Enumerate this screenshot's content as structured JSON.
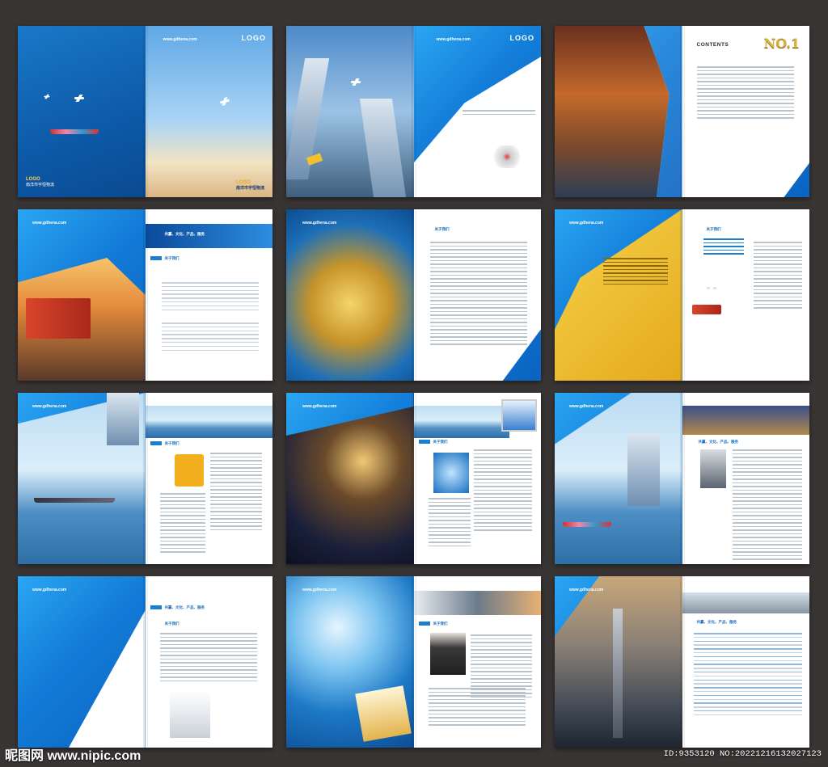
{
  "url": "www.gdhena.com",
  "logo": "LOGO",
  "cover_brand_name": "南洋市宇恒物流",
  "contents_title": "CONTENTS",
  "no1_badge": "NO.1",
  "section_heading": "关于我们",
  "brochure_title": "共赢、文化、产品、服务",
  "watermark_site": "昵图网 www.nipic.com",
  "watermark_id": "ID:9353120 NO:20221216132027123",
  "colors": {
    "background": "#3a3535",
    "brand_blue": "#1a7fd0",
    "accent_yellow": "#f2c12e"
  }
}
